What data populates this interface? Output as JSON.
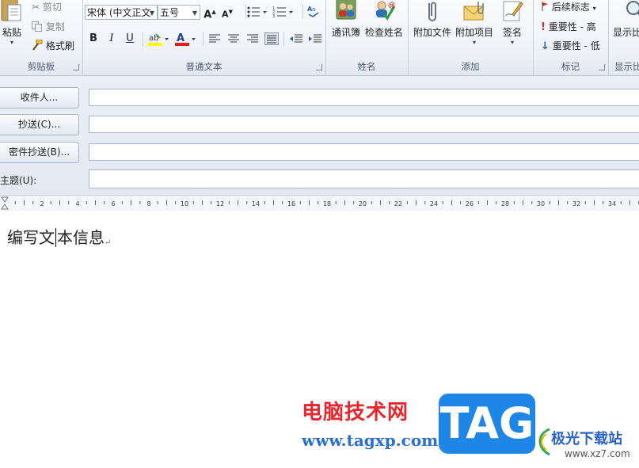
{
  "ribbon": {
    "clipboard": {
      "paste_label": "粘贴",
      "cut_label": "剪切",
      "copy_label": "复制",
      "format_painter_label": "格式刷",
      "group_label": "剪贴板"
    },
    "basic_text": {
      "font_name": "宋体 (中文正文",
      "font_size": "五号",
      "grow_font": "A",
      "shrink_font": "A",
      "bold": "B",
      "italic": "I",
      "underline": "U",
      "group_label": "普通文本"
    },
    "names": {
      "address_book_label": "通讯簿",
      "check_names_label": "检查姓名",
      "group_label": "姓名"
    },
    "include": {
      "attach_file_label": "附加文件",
      "attach_item_label": "附加项目",
      "signature_label": "签名",
      "group_label": "添加"
    },
    "tags": {
      "follow_up_label": "后续标志",
      "high_importance_label": "重要性 - 高",
      "low_importance_label": "重要性 - 低",
      "group_label": "标记"
    },
    "zoom": {
      "zoom_label": "显示比",
      "group_label": "显示比"
    }
  },
  "header": {
    "to_button": "收件人...",
    "cc_button": "抄送(C)...",
    "bcc_button": "密件抄送(B)...",
    "subject_label": "主题(U):",
    "to_value": "",
    "cc_value": "",
    "bcc_value": "",
    "subject_value": ""
  },
  "ruler": {
    "labels": [
      "2",
      "4",
      "6",
      "8",
      "10",
      "12",
      "14",
      "16",
      "18",
      "20",
      "22",
      "24",
      "26",
      "28",
      "30",
      "32",
      "34"
    ]
  },
  "body": {
    "text_before_caret": "编写文",
    "text_after_caret": "本信息",
    "paragraph_mark": "↵"
  },
  "watermark": {
    "site_name": "电脑技术网",
    "site_url": "www.tagxp.com",
    "tag_text": "TAG",
    "site_name2": "极光下载站",
    "site_url2": "www.xz7.com"
  },
  "colors": {
    "highlight_yellow": "#ffff00",
    "font_red": "#e02020",
    "flag_red": "#d0301c",
    "importance_blue": "#2b5bb5"
  }
}
